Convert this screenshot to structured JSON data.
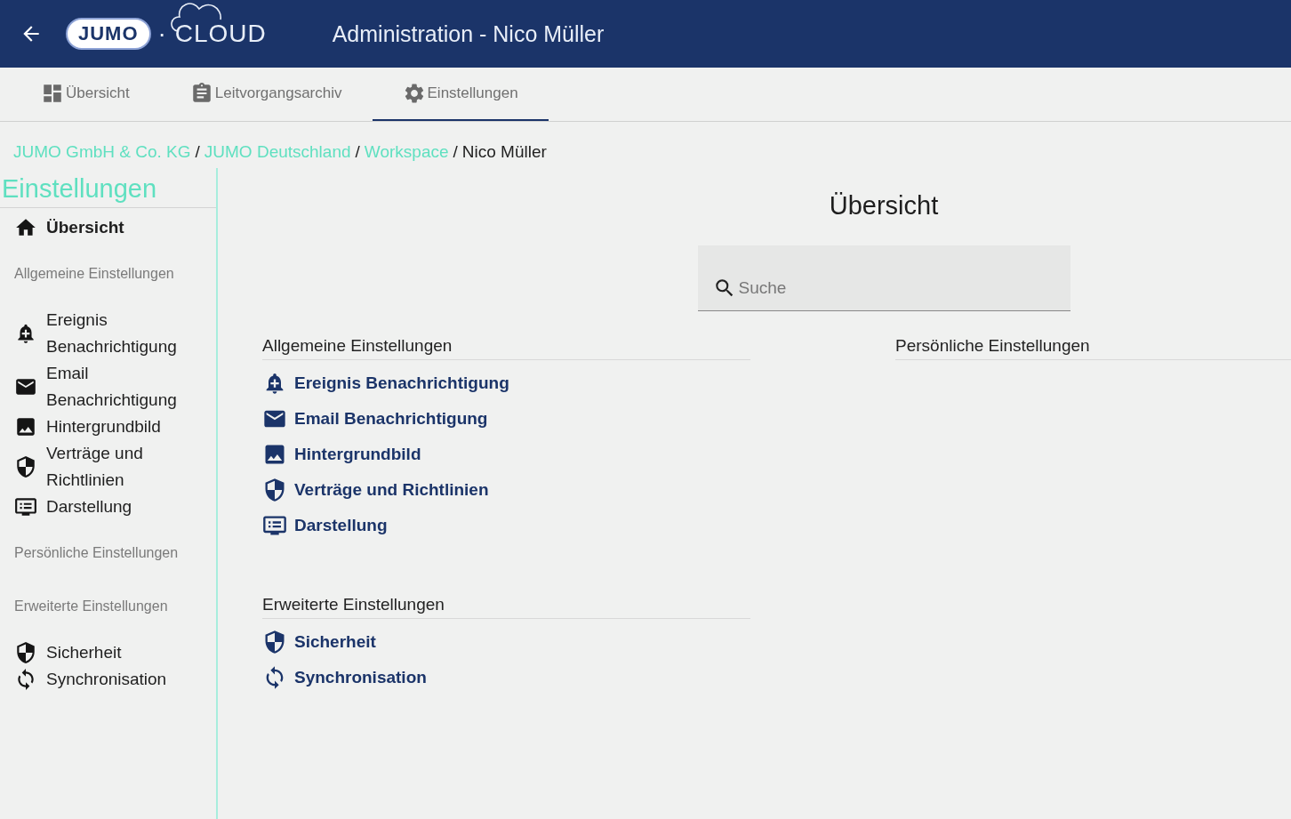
{
  "header": {
    "logo_badge": "JUMO",
    "logo_text": "· CLOUD",
    "title": "Administration - Nico Müller"
  },
  "tabs": [
    {
      "label": "Übersicht",
      "selected": false
    },
    {
      "label": "Leitvorgangsarchiv",
      "selected": false
    },
    {
      "label": "Einstellungen",
      "selected": true
    }
  ],
  "breadcrumb_separator": "/",
  "breadcrumb": [
    {
      "label": "JUMO GmbH & Co. KG",
      "kind": "link"
    },
    {
      "label": "JUMO Deutschland",
      "kind": "link"
    },
    {
      "label": "Workspace",
      "kind": "link"
    },
    {
      "label": "Nico Müller",
      "kind": "current"
    }
  ],
  "sidebar": {
    "title": "Einstellungen",
    "items": [
      {
        "kind": "link",
        "label": "Übersicht",
        "selected": true
      },
      {
        "kind": "heading",
        "label": "Allgemeine Einstellungen"
      },
      {
        "kind": "link",
        "label": "Ereignis Benachrichtigung",
        "selected": false
      },
      {
        "kind": "link",
        "label": "Email Benachrichtigung",
        "selected": false
      },
      {
        "kind": "link",
        "label": "Hintergrundbild",
        "selected": false
      },
      {
        "kind": "link",
        "label": "Verträge und Richtlinien",
        "selected": false
      },
      {
        "kind": "link",
        "label": "Darstellung",
        "selected": false
      },
      {
        "kind": "heading",
        "label": "Persönliche Einstellungen"
      },
      {
        "kind": "heading",
        "label": "Erweiterte Einstellungen"
      },
      {
        "kind": "link",
        "label": "Sicherheit",
        "selected": false
      },
      {
        "kind": "link",
        "label": "Synchronisation",
        "selected": false
      }
    ]
  },
  "main": {
    "title": "Übersicht",
    "search": {
      "placeholder": "Suche"
    },
    "sections": [
      {
        "heading": "Allgemeine Einstellungen",
        "links": [
          "Ereignis Benachrichtigung",
          "Email Benachrichtigung",
          "Hintergrundbild",
          "Verträge und Richtlinien",
          "Darstellung"
        ]
      },
      {
        "heading": "Persönliche Einstellungen"
      },
      {
        "heading": "Erweiterte Einstellungen",
        "links": [
          "Sicherheit",
          "Synchronisation"
        ]
      }
    ]
  }
}
